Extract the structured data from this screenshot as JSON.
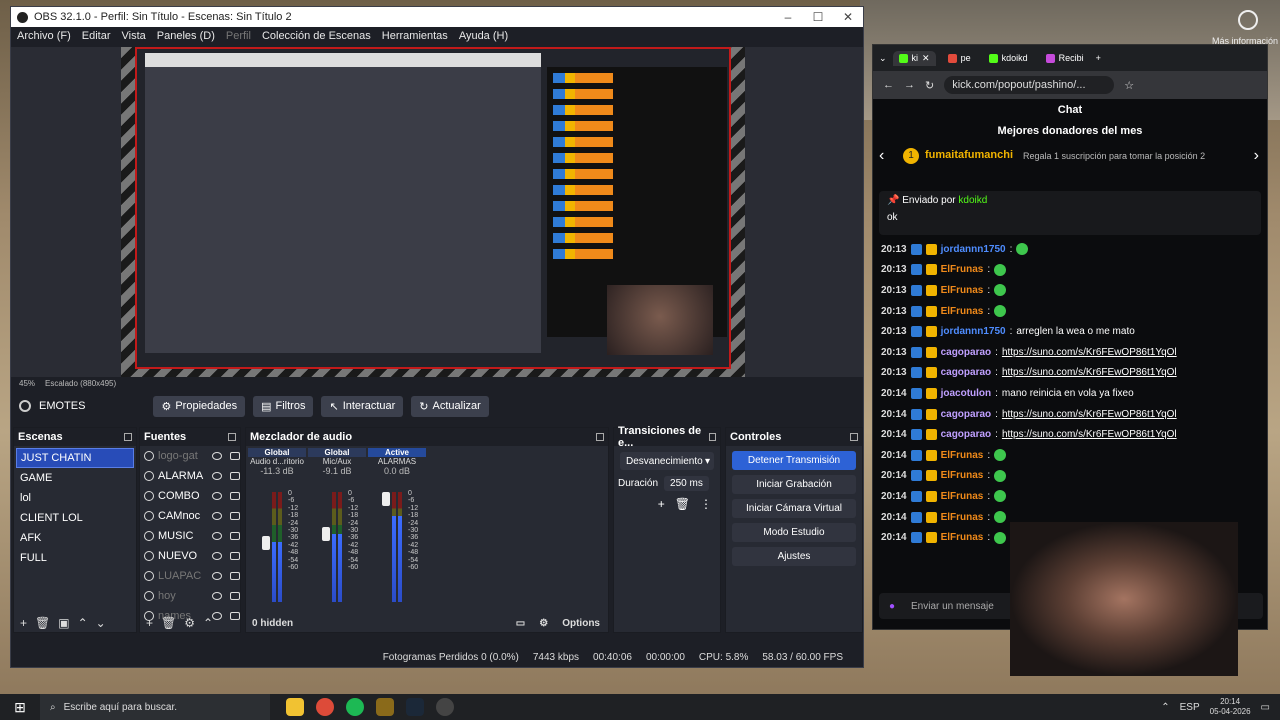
{
  "desktop": {
    "sys_label": "Más información"
  },
  "obs": {
    "title": "OBS 32.1.0 - Perfil: Sin Título - Escenas: Sin Título 2",
    "menu": [
      "Archivo (F)",
      "Editar",
      "Vista",
      "Paneles (D)",
      "Perfil",
      "Colección de Escenas",
      "Herramientas",
      "Ayuda (H)"
    ],
    "zoom_label": "45%",
    "scale_label": "Escalado (880x495)",
    "current_scene": "EMOTES",
    "scene_buttons": [
      "Propiedades",
      "Filtros",
      "Interactuar",
      "Actualizar"
    ],
    "scenes_title": "Escenas",
    "scenes": [
      "JUST CHATIN",
      "GAME",
      "lol",
      "CLIENT LOL",
      "AFK",
      "FULL"
    ],
    "sources_title": "Fuentes",
    "sources": [
      {
        "name": "logo-gat",
        "visible": false
      },
      {
        "name": "ALARMA",
        "visible": true
      },
      {
        "name": "COMBO",
        "visible": true
      },
      {
        "name": "CAMnoc",
        "visible": true
      },
      {
        "name": "MUSIC",
        "visible": true
      },
      {
        "name": "NUEVO",
        "visible": true
      },
      {
        "name": "LUAPAC",
        "visible": false
      },
      {
        "name": "hoy",
        "visible": false
      },
      {
        "name": "names",
        "visible": false
      }
    ],
    "mixer_title": "Mezclador de audio",
    "mixer": [
      {
        "tag": "Global",
        "name": "Audio d...ritorio",
        "db": "-11.3 dB",
        "level": 0.55,
        "fader": 0.6
      },
      {
        "tag": "Global",
        "name": "Mic/Aux",
        "db": "-9.1 dB",
        "level": 0.62,
        "fader": 0.68
      },
      {
        "tag": "Active",
        "name": "ALARMAS",
        "db": "0.0 dB",
        "level": 0.78,
        "fader": 1.0
      }
    ],
    "mixer_scale": [
      "0",
      "-6",
      "-12",
      "-18",
      "-24",
      "-30",
      "-36",
      "-42",
      "-48",
      "-54",
      "-60"
    ],
    "hidden_label": "0 hidden",
    "options_label": "Options",
    "transitions_title": "Transiciones de e...",
    "transition": "Desvanecimiento",
    "duration_label": "Duración",
    "duration_value": "250 ms",
    "controls_title": "Controles",
    "controls": [
      "Detener Transmisión",
      "Iniciar Grabación",
      "Iniciar Cámara Virtual",
      "Modo Estudio",
      "Ajustes"
    ],
    "status": {
      "dropped": "Fotogramas Perdidos 0 (0.0%)",
      "bitrate": "7443 kbps",
      "stream_time": "00:40:06",
      "rec_time": "00:00:00",
      "cpu": "CPU: 5.8%",
      "fps": "58.03 / 60.00 FPS"
    }
  },
  "browser": {
    "tabs": [
      "ki",
      "pe",
      "kdoikd",
      "Recibi"
    ],
    "url": "kick.com/popout/pashino/...",
    "chat_title": "Chat",
    "donors_title": "Mejores donadores del mes",
    "donor_rank": "1",
    "donor_name": "fumaitafumanchi",
    "donor_sub": "Regala 1 suscripción para tomar la posición 2",
    "pinned_label": "Enviado por",
    "pinned_user": "kdoikd",
    "pinned_text": "ok",
    "messages": [
      {
        "time": "20:13",
        "user": "jordannn1750",
        "color": "#4f8dff",
        "text": ""
      },
      {
        "time": "20:13",
        "user": "ElFrunas",
        "color": "#f08a1a",
        "text": ""
      },
      {
        "time": "20:13",
        "user": "ElFrunas",
        "color": "#f08a1a",
        "text": ""
      },
      {
        "time": "20:13",
        "user": "ElFrunas",
        "color": "#f08a1a",
        "text": ""
      },
      {
        "time": "20:13",
        "user": "jordannn1750",
        "color": "#4f8dff",
        "text": "arreglen la wea o me mato"
      },
      {
        "time": "20:13",
        "user": "cagoparao",
        "color": "#c0a0ff",
        "text": "https://suno.com/s/Kr6FEwOP86t1YqOl"
      },
      {
        "time": "20:13",
        "user": "cagoparao",
        "color": "#c0a0ff",
        "text": "https://suno.com/s/Kr6FEwOP86t1YqOl"
      },
      {
        "time": "20:14",
        "user": "joacotulon",
        "color": "#c0a0ff",
        "text": "mano reinicia en vola ya fixeo"
      },
      {
        "time": "20:14",
        "user": "cagoparao",
        "color": "#c0a0ff",
        "text": "https://suno.com/s/Kr6FEwOP86t1YqOl"
      },
      {
        "time": "20:14",
        "user": "cagoparao",
        "color": "#c0a0ff",
        "text": "https://suno.com/s/Kr6FEwOP86t1YqOl"
      },
      {
        "time": "20:14",
        "user": "ElFrunas",
        "color": "#f08a1a",
        "text": ""
      },
      {
        "time": "20:14",
        "user": "ElFrunas",
        "color": "#f08a1a",
        "text": ""
      },
      {
        "time": "20:14",
        "user": "ElFrunas",
        "color": "#f08a1a",
        "text": ""
      },
      {
        "time": "20:14",
        "user": "ElFrunas",
        "color": "#f08a1a",
        "text": ""
      },
      {
        "time": "20:14",
        "user": "ElFrunas",
        "color": "#f08a1a",
        "text": ""
      }
    ],
    "send_placeholder": "Enviar un mensaje"
  },
  "taskbar": {
    "search_placeholder": "Escribe aquí para buscar.",
    "lang": "ESP",
    "time": "20:14",
    "date": "05-04-2026"
  }
}
